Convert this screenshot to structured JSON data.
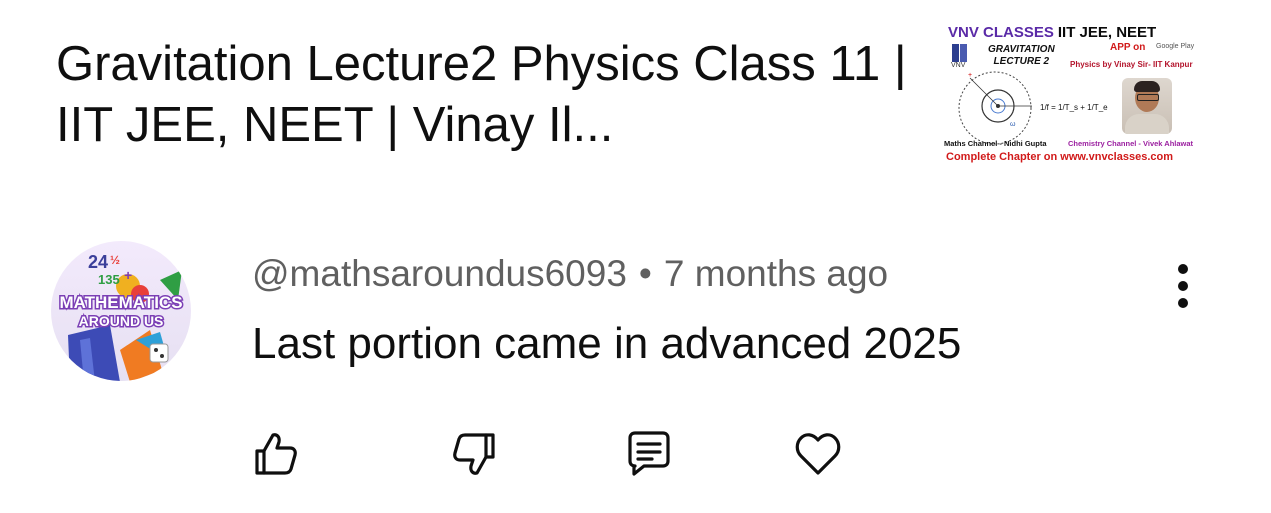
{
  "video": {
    "title": "Gravitation Lecture2 Physics Class 11 | IIT JEE, NEET | Vinay Il..."
  },
  "thumbnail": {
    "brand": "VNV CLASSES",
    "exam": "IIT JEE, NEET",
    "topic_line1": "GRAVITATION",
    "topic_line2": "LECTURE 2",
    "app_text": "APP on",
    "store_text": "Google Play",
    "physics_by": "Physics by Vinay Sir- IIT Kanpur",
    "logo_text": "VNV",
    "maths_channel": "Maths Channel - Nidhi Gupta",
    "chemistry_channel": "Chemistry Channel - Vivek Ahlawat",
    "complete_chapter": "Complete Chapter on www.vnvclasses.com",
    "formula": "1/f = 1/T_s + 1/T_e"
  },
  "comment": {
    "avatar_text_line1": "MATHEMATICS",
    "avatar_text_line2": "AROUND US",
    "handle": "@mathsaroundus6093",
    "separator": "•",
    "time": "7 months ago",
    "text": "Last portion came in advanced 2025"
  },
  "actions": [
    {
      "icon": "like-icon"
    },
    {
      "icon": "dislike-icon"
    },
    {
      "icon": "reply-icon"
    },
    {
      "icon": "heart-icon"
    }
  ],
  "colors": {
    "text_primary": "#0f0f0f",
    "text_secondary": "#606060",
    "brand_purple": "#5a2aa7",
    "accent_red": "#d11a1a"
  }
}
